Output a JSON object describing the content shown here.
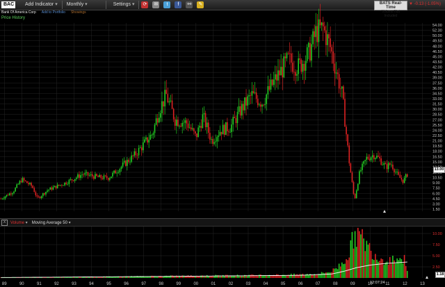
{
  "toolbar": {
    "symbol": "BAC",
    "add_indicator": "Add Indicator",
    "interval": "Monthly",
    "settings": "Settings"
  },
  "quote_source": {
    "title": "BATS Real-Time",
    "subtitle": "Volume Not Included"
  },
  "price_change": "▼ -0.13 (-1.05%)",
  "subheader": {
    "company": "Bank Of America Corp",
    "add_portfolio": "Add to Portfolio",
    "showings": "Showings"
  },
  "price_panel": {
    "label": "Price History"
  },
  "volume_panel": {
    "close_label": "X",
    "volume_label": "Volume",
    "ma_label": "Moving Average 50"
  },
  "last_price": "13.00",
  "last_volume": "1.18",
  "timestamp": "12:07:24",
  "colors": {
    "up": "#22cc22",
    "down": "#dd2222",
    "ma": "#ffffff",
    "axis_text": "#cccccc"
  },
  "chart_data": {
    "type": "candlestick",
    "interval": "monthly",
    "price_axis": {
      "ticks": [
        "54.00",
        "52.30",
        "50.00",
        "49.50",
        "48.00",
        "46.50",
        "45.00",
        "43.50",
        "42.00",
        "40.50",
        "39.00",
        "37.50",
        "36.00",
        "34.50",
        "33.00",
        "31.50",
        "30.00",
        "28.50",
        "27.00",
        "25.50",
        "24.00",
        "22.50",
        "21.00",
        "19.50",
        "18.00",
        "16.50",
        "15.00",
        "13.50",
        "12.00",
        "10.50",
        "9.00",
        "7.50",
        "6.00",
        "4.50",
        "3.00",
        "1.50"
      ]
    },
    "volume_axis": {
      "ticks": [
        "10.00",
        "7.50",
        "5.00",
        "2.50"
      ],
      "ylim": [
        0,
        10
      ]
    },
    "x_axis": {
      "ticks": [
        "89",
        "90",
        "91",
        "92",
        "93",
        "94",
        "95",
        "96",
        "97",
        "98",
        "99",
        "00",
        "01",
        "02",
        "03",
        "04",
        "05",
        "06",
        "07",
        "08",
        "09",
        "10",
        "11",
        "12",
        "13"
      ],
      "range": [
        1988.75,
        2013.5
      ]
    },
    "price_trend": {
      "years": [
        1988.8,
        1989.5,
        1990.0,
        1990.6,
        1990.9,
        1991.5,
        1992.5,
        1993.5,
        1994.5,
        1995.0,
        1995.8,
        1996.5,
        1997.5,
        1997.9,
        1998.3,
        1998.8,
        1999.5,
        2000.0,
        2000.4,
        2000.9,
        2001.4,
        2002.0,
        2002.6,
        2003.2,
        2003.8,
        2004.5,
        2005.3,
        2005.9,
        2006.5,
        2006.9,
        2007.3,
        2007.7,
        2008.0,
        2008.4,
        2008.8,
        2009.1,
        2009.4,
        2009.8,
        2010.2,
        2010.5,
        2010.9,
        2011.2,
        2011.6,
        2011.9,
        2012.2
      ],
      "closes": [
        4.5,
        6.5,
        10.0,
        8.0,
        4.5,
        7.0,
        9.0,
        11.5,
        10.5,
        10.5,
        14.0,
        17.0,
        23.0,
        30.0,
        34.0,
        27.0,
        26.0,
        22.0,
        28.0,
        21.0,
        24.0,
        25.0,
        30.0,
        34.0,
        32.0,
        38.0,
        44.0,
        42.0,
        46.0,
        52.0,
        53.0,
        48.0,
        42.0,
        34.0,
        15.0,
        4.0,
        12.0,
        16.0,
        17.0,
        16.0,
        13.5,
        14.5,
        11.0,
        9.5,
        12.0
      ]
    },
    "volume_trend": {
      "years": [
        1988.8,
        1995.0,
        2000.0,
        2005.0,
        2007.0,
        2007.8,
        2008.3,
        2008.8,
        2009.1,
        2009.5,
        2010.0,
        2010.5,
        2011.0,
        2011.5,
        2012.0,
        2012.2
      ],
      "values": [
        0.1,
        0.3,
        0.5,
        0.7,
        0.9,
        1.5,
        3.0,
        5.5,
        10.0,
        9.0,
        6.5,
        4.5,
        4.0,
        4.5,
        4.0,
        1.2
      ]
    },
    "ma_trend": {
      "years": [
        1988.8,
        2000.0,
        2006.0,
        2007.8,
        2008.5,
        2009.2,
        2010.0,
        2011.0,
        2012.2
      ],
      "values": [
        0.1,
        0.4,
        0.6,
        0.9,
        1.5,
        2.3,
        2.9,
        3.3,
        3.6
      ]
    }
  }
}
